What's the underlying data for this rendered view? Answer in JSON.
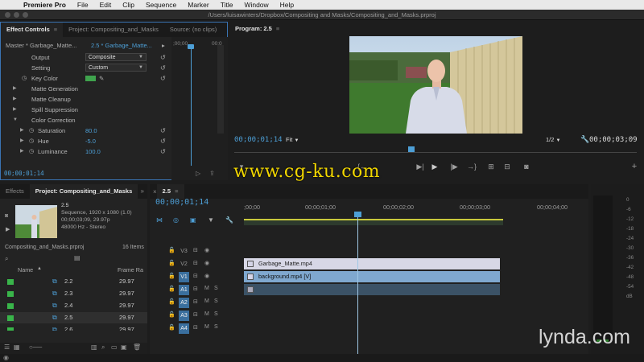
{
  "menubar": {
    "app": "Premiere Pro",
    "items": [
      "File",
      "Edit",
      "Clip",
      "Sequence",
      "Marker",
      "Title",
      "Window",
      "Help"
    ]
  },
  "window": {
    "title": "/Users/luisawinters/Dropbox/Compositing and Masks/Compositing_and_Masks.prproj"
  },
  "effect_controls": {
    "tabs": [
      "Effect Controls",
      "Project: Compositing_and_Masks",
      "Source: (no clips)"
    ],
    "master_label": "Master * Garbage_Matte...",
    "clip_label": "2.5 * Garbage_Matte...",
    "ruler_tc": ";00;00",
    "ruler_tc2": "00;0",
    "rows": {
      "output": {
        "label": "Output",
        "value": "Composite"
      },
      "setting": {
        "label": "Setting",
        "value": "Custom"
      },
      "key_color": {
        "label": "Key Color"
      },
      "matte_generation": "Matte Generation",
      "matte_cleanup": "Matte Cleanup",
      "spill_suppression": "Spill Suppression",
      "color_correction": "Color Correction",
      "saturation": {
        "label": "Saturation",
        "value": "80.0"
      },
      "hue": {
        "label": "Hue",
        "value": "-5.0"
      },
      "luminance": {
        "label": "Luminance",
        "value": "100.0"
      }
    },
    "footer_tc": "00;00;01;14",
    "key_color_hex": "#3fa34d"
  },
  "program": {
    "tab": "Program: 2.5",
    "current_tc": "00;00;01;14",
    "fit": "Fit",
    "resolution": "1/2",
    "duration_tc": "00;00;03;09"
  },
  "project": {
    "tabs": [
      "Effects",
      "Project: Compositing_and_Masks"
    ],
    "seq_name": "2.5",
    "seq_line1": "Sequence, 1920 x 1080 (1.0)",
    "seq_line2": "00;00;03;09, 29.97p",
    "seq_line3": "48000 Hz - Stereo",
    "file": "Compositing_and_Masks.prproj",
    "count": "16 Items",
    "col_name": "Name",
    "col_frame": "Frame Ra",
    "rows": [
      {
        "name": "2.2",
        "frame": "29.97"
      },
      {
        "name": "2.3",
        "frame": "29.97"
      },
      {
        "name": "2.4",
        "frame": "29.97"
      },
      {
        "name": "2.5",
        "frame": "29.97"
      },
      {
        "name": "2.6",
        "frame": "29.97"
      }
    ]
  },
  "timeline": {
    "tab": "2.5",
    "current_tc": "00;00;01;14",
    "ruler": [
      ";00;00",
      "00;00;01;00",
      "00;00;02;00",
      "00;00;03;00",
      "00;00;04;00"
    ],
    "tracks": [
      {
        "name": "V3",
        "b1": "⊟",
        "b2": "◉"
      },
      {
        "name": "V2",
        "b1": "⊟",
        "b2": "◉"
      },
      {
        "name": "V1",
        "b1": "⊟",
        "b2": "◉"
      },
      {
        "name": "A1",
        "b1": "⊟",
        "b2": "M",
        "b3": "S"
      },
      {
        "name": "A2",
        "b1": "⊟",
        "b2": "M",
        "b3": "S"
      },
      {
        "name": "A3",
        "b1": "⊟",
        "b2": "M",
        "b3": "S"
      },
      {
        "name": "A4",
        "b1": "⊟",
        "b2": "M",
        "b3": "S"
      }
    ],
    "clips": {
      "v2": "Garbage_Matte.mp4",
      "v1": "background.mp4 [V]"
    }
  },
  "audio_meter": {
    "scale": [
      "0",
      "-6",
      "-12",
      "-18",
      "-24",
      "-30",
      "-36",
      "-42",
      "-48",
      "-54",
      "dB"
    ]
  },
  "watermarks": {
    "cg": "www.cg-ku.com",
    "lynda": "lynda.com"
  }
}
